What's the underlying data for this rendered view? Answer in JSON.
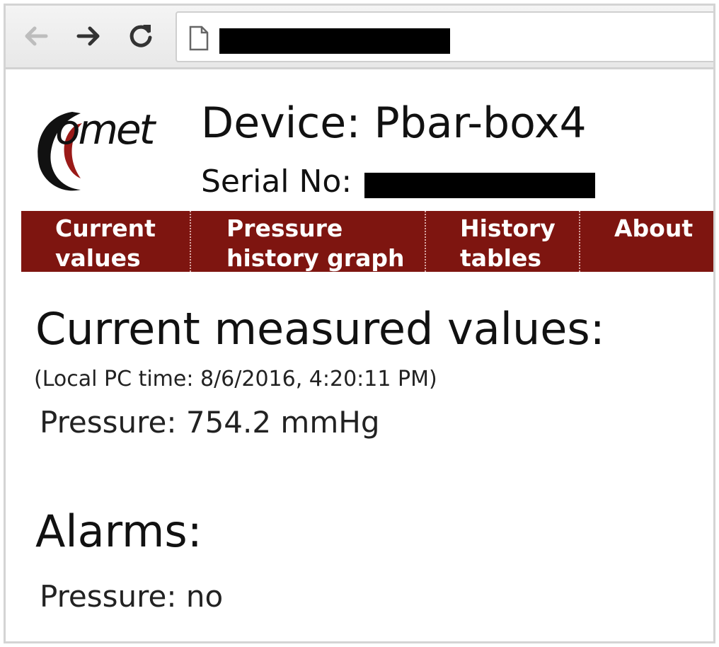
{
  "browser": {
    "back_icon": "arrow-left-icon",
    "forward_icon": "arrow-right-icon",
    "reload_icon": "reload-icon",
    "page_icon": "page-icon",
    "url": ""
  },
  "header": {
    "logo_text": "omet",
    "device_title": "Device: Pbar-box4",
    "serial_label": "Serial No:",
    "serial_value": ""
  },
  "menu": {
    "items": [
      {
        "label": "Current\nvalues"
      },
      {
        "label": "Pressure\nhistory graph"
      },
      {
        "label": "History\ntables"
      },
      {
        "label": "About"
      }
    ]
  },
  "current": {
    "title": "Current measured values:",
    "local_time": "(Local PC time: 8/6/2016, 4:20:11 PM)",
    "pressure": "Pressure: 754.2 mmHg"
  },
  "alarms": {
    "title": "Alarms:",
    "pressure": "Pressure: no"
  },
  "colors": {
    "menu_background": "#7e1510",
    "logo_red": "#9a1a18"
  }
}
